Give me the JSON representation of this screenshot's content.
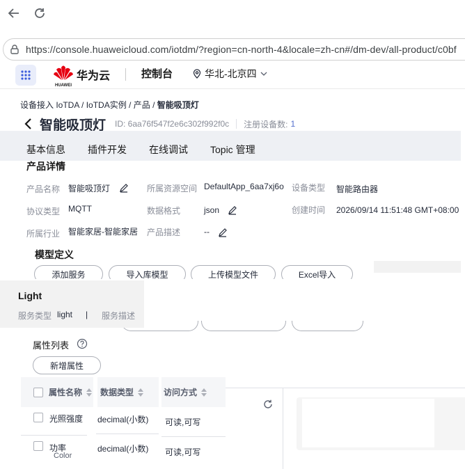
{
  "browser": {
    "url": "https://console.huaweicloud.com/iotdm/?region=cn-north-4&locale=zh-cn#/dm-dev/all-product/c0bf"
  },
  "header": {
    "logo_text": "HUAWEI",
    "brand": "华为云",
    "console": "控制台",
    "region": "华北-北京四"
  },
  "breadcrumb": {
    "items": [
      "设备接入 IoTDA",
      "IoTDA实例",
      "产品"
    ],
    "separator": " / ",
    "current": "智能吸顶灯"
  },
  "title": {
    "name": "智能吸顶灯",
    "id": "ID: 6aa76f547f2e6c302f992f0c",
    "registered_label": "注册设备数:",
    "registered_count": "1"
  },
  "tabs": [
    "基本信息",
    "插件开发",
    "在线调试",
    "Topic 管理"
  ],
  "product_details": {
    "title": "产品详情",
    "fields": {
      "name_label": "产品名称",
      "name_value": "智能吸顶灯",
      "space_label": "所属资源空间",
      "space_value": "DefaultApp_6aa7xj6o",
      "type_label": "设备类型",
      "type_value": "智能路由器",
      "protocol_label": "协议类型",
      "protocol_value": "MQTT",
      "format_label": "数据格式",
      "format_value": "json",
      "created_label": "创建时间",
      "created_value": "2026/09/14 11:51:48 GMT+08:00",
      "industry_label": "所属行业",
      "industry_value": "智能家居-智能家居",
      "desc_label": "产品描述",
      "desc_value": "--"
    }
  },
  "model": {
    "title": "模型定义",
    "buttons": [
      "添加服务",
      "导入库模型",
      "上传模型文件",
      "Excel导入"
    ]
  },
  "service": {
    "name": "Light",
    "type_label": "服务类型",
    "type_value": "light",
    "divider": "|",
    "desc_label": "服务描述"
  },
  "properties": {
    "title": "属性列表",
    "add_button": "新增属性",
    "columns": [
      "属性名称",
      "数据类型",
      "访问方式"
    ],
    "rows": [
      {
        "name": "光照强度",
        "type": "decimal(小数)",
        "access": "可读,可写"
      },
      {
        "name": "功率",
        "type": "decimal(小数)",
        "access": "可读,可写"
      }
    ],
    "overflow_text": "Color"
  }
}
